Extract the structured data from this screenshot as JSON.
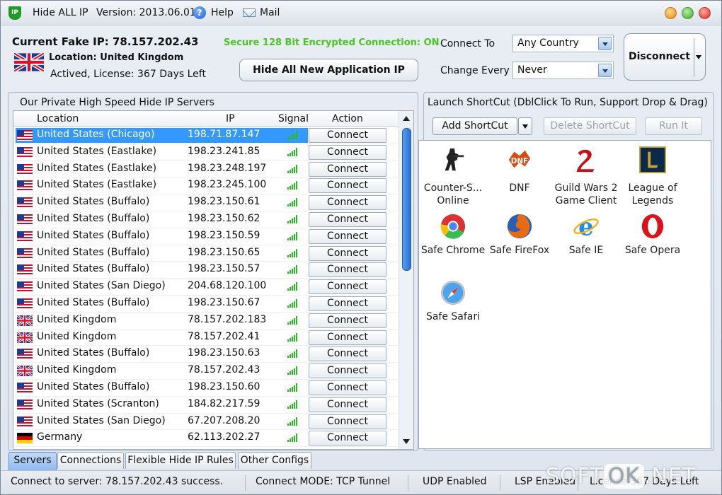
{
  "titlebar": {
    "app_name": "Hide ALL IP",
    "version": "Version: 2013.06.01",
    "help": "Help",
    "mail": "Mail",
    "app_icon_text": "IP"
  },
  "header": {
    "current_ip": "Current Fake IP: 78.157.202.43",
    "location": "Location: United Kingdom",
    "license": "Actived, License: 367 Days Left",
    "secure_status": "Secure 128 Bit Encrypted Connection: ON",
    "hide_all_button": "Hide All New Application IP",
    "connect_to_label": "Connect To",
    "connect_to_value": "Any Country",
    "change_every_label": "Change Every",
    "change_every_value": "Never",
    "disconnect_button": "Disconnect"
  },
  "servers_panel": {
    "title": "Our Private High Speed Hide IP Servers",
    "columns": [
      "Location",
      "IP",
      "Signal",
      "Action"
    ],
    "rows": [
      {
        "flag": "us",
        "location": "United States (Chicago)",
        "ip": "198.71.87.147",
        "action": "Connect",
        "selected": true
      },
      {
        "flag": "us",
        "location": "United States (Eastlake)",
        "ip": "198.23.241.85",
        "action": "Connect"
      },
      {
        "flag": "us",
        "location": "United States (Eastlake)",
        "ip": "198.23.248.197",
        "action": "Connect"
      },
      {
        "flag": "us",
        "location": "United States (Eastlake)",
        "ip": "198.23.245.100",
        "action": "Connect"
      },
      {
        "flag": "us",
        "location": "United States (Buffalo)",
        "ip": "198.23.150.61",
        "action": "Connect"
      },
      {
        "flag": "us",
        "location": "United States (Buffalo)",
        "ip": "198.23.150.62",
        "action": "Connect"
      },
      {
        "flag": "us",
        "location": "United States (Buffalo)",
        "ip": "198.23.150.59",
        "action": "Connect"
      },
      {
        "flag": "us",
        "location": "United States (Buffalo)",
        "ip": "198.23.150.65",
        "action": "Connect"
      },
      {
        "flag": "us",
        "location": "United States (Buffalo)",
        "ip": "198.23.150.57",
        "action": "Connect"
      },
      {
        "flag": "us",
        "location": "United States (San Diego)",
        "ip": "204.68.120.100",
        "action": "Connect"
      },
      {
        "flag": "us",
        "location": "United States (Buffalo)",
        "ip": "198.23.150.67",
        "action": "Connect"
      },
      {
        "flag": "uk",
        "location": "United Kingdom",
        "ip": "78.157.202.183",
        "action": "Connect"
      },
      {
        "flag": "uk",
        "location": "United Kingdom",
        "ip": "78.157.202.41",
        "action": "Connect"
      },
      {
        "flag": "us",
        "location": "United States (Buffalo)",
        "ip": "198.23.150.63",
        "action": "Connect"
      },
      {
        "flag": "uk",
        "location": "United Kingdom",
        "ip": "78.157.202.43",
        "action": "Connect"
      },
      {
        "flag": "us",
        "location": "United States (Buffalo)",
        "ip": "198.23.150.60",
        "action": "Connect"
      },
      {
        "flag": "us",
        "location": "United States (Scranton)",
        "ip": "184.82.217.59",
        "action": "Connect"
      },
      {
        "flag": "us",
        "location": "United States (San Diego)",
        "ip": "67.207.208.20",
        "action": "Connect"
      },
      {
        "flag": "de",
        "location": "Germany",
        "ip": "62.113.202.27",
        "action": "Connect"
      }
    ]
  },
  "shortcut_panel": {
    "title": "Launch ShortCut (DblClick To Run, Support Drop & Drag)",
    "add_button": "Add ShortCut",
    "delete_button": "Delete ShortCut",
    "run_button": "Run It",
    "items": [
      {
        "icon": "counter-strike-icon",
        "label": "Counter-S... Online"
      },
      {
        "icon": "dnf-icon",
        "label": "DNF"
      },
      {
        "icon": "guild-wars-icon",
        "label": "Guild Wars 2 Game Client"
      },
      {
        "icon": "league-of-legends-icon",
        "label": "League of Legends"
      },
      {
        "icon": "chrome-icon",
        "label": "Safe Chrome"
      },
      {
        "icon": "firefox-icon",
        "label": "Safe FireFox"
      },
      {
        "icon": "ie-icon",
        "label": "Safe IE"
      },
      {
        "icon": "opera-icon",
        "label": "Safe Opera"
      },
      {
        "icon": "safari-icon",
        "label": "Safe Safari"
      }
    ]
  },
  "tabs": [
    {
      "label": "Servers",
      "active": true
    },
    {
      "label": "Connections"
    },
    {
      "label": "Flexible Hide IP Rules"
    },
    {
      "label": "Other Configs"
    }
  ],
  "statusbar": {
    "message": "Connect to server: 78.157.202.43 success.",
    "mode": "Connect MODE: TCP Tunnel",
    "udp": "UDP Enabled",
    "lsp": "LSP Enabled",
    "license": "License 367 Days Left"
  },
  "watermark": {
    "left": "SOFT",
    "mid": "OK",
    "right": ".NET"
  }
}
